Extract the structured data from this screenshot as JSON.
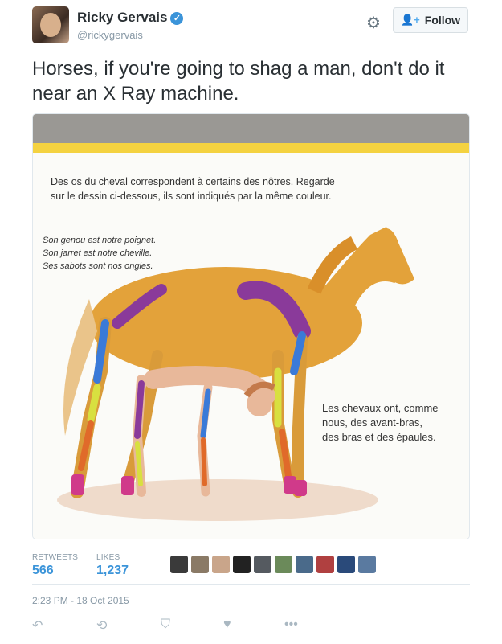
{
  "user": {
    "name": "Ricky Gervais",
    "handle": "@rickygervais"
  },
  "follow_button": {
    "label": "Follow",
    "icon": "add-user-icon"
  },
  "tweet_text": "Horses, if you're going to shag a man, don't do it near an X Ray machine.",
  "media": {
    "top_text_1": "Des os du cheval correspondent à certains des nôtres. Regarde",
    "top_text_2": "sur le dessin ci-dessous, ils sont indiqués par la même couleur.",
    "left_line_1": "Son genou est notre poignet.",
    "left_line_2": "Son jarret est notre cheville.",
    "left_line_3": "Ses sabots sont nos ongles.",
    "right_line_1": "Les chevaux ont, comme",
    "right_line_2": "nous, des avant-bras,",
    "right_line_3": "des bras et des épaules."
  },
  "stats": {
    "retweets_label": "RETWEETS",
    "retweets_value": "566",
    "likes_label": "LIKES",
    "likes_value": "1,237"
  },
  "favoriters_colors": [
    "#3a3a3a",
    "#8a7a66",
    "#c9a58a",
    "#222222",
    "#555a60",
    "#6b8a5a",
    "#4a6a8a",
    "#b04040",
    "#2a4a7a",
    "#5a7aa0"
  ],
  "timestamp": "2:23 PM - 18 Oct 2015",
  "actions": [
    "reply-icon",
    "retweet-icon",
    "save-icon",
    "like-icon",
    "more-icon"
  ],
  "colors": {
    "accent": "#3b94d9",
    "muted": "#8899a6"
  }
}
